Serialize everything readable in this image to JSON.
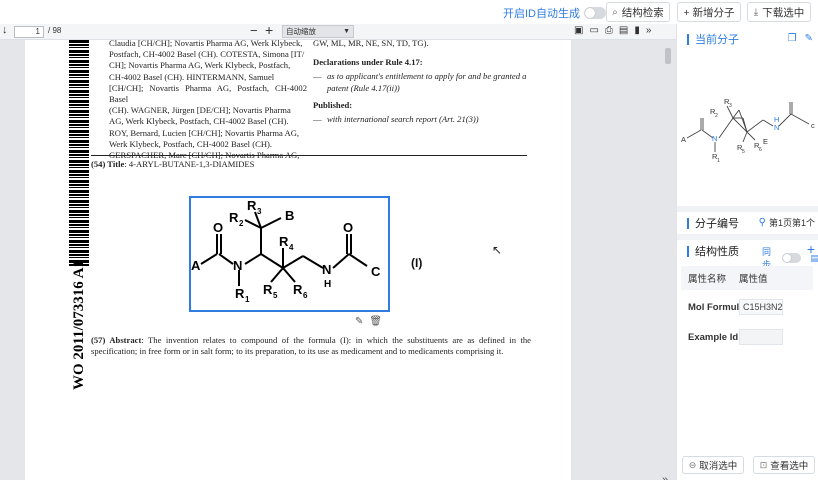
{
  "topbar": {
    "id_toggle_label": "开启ID自动生成",
    "structure_search": "结构检索",
    "add_molecule": "+ 新增分子",
    "download_selected": "下载选中"
  },
  "pdf_toolbar": {
    "back_arrow": "↓",
    "page_current": "1",
    "page_total": "/ 98",
    "zoom_minus": "−",
    "zoom_plus": "+",
    "zoom_value": "自动缩放"
  },
  "document": {
    "wo_number": "WO 2011/073316 A1",
    "left_col_lines": [
      "Claudia [CH/CH]; Novartis Pharma AG, Werk Klybeck,",
      "Postfach, CH-4002 Basel (CH). COTESTA, Simona [IT/",
      "CH]; Novartis Pharma AG, Werk Klybeck, Postfach,",
      "CH-4002 Basel (CH). HINTERMANN, Samuel",
      "[CH/CH]; Novartis Pharma AG, Postfach, CH-4002 Basel",
      "(CH). WAGNER, Jürgen [DE/CH]; Novartis Pharma",
      "AG, Werk Klybeck, Postfach, CH-4002 Basel (CH).",
      "ROY, Bernard, Lucien [CH/CH]; Novartis Pharma AG,",
      "Werk Klybeck, Postfach, CH-4002 Basel (CH).",
      "GERSPACHER, Marc [CH/CH]; Novartis Pharma AG,"
    ],
    "right_col_top": "GW, ML, MR, NE, SN, TD, TG).",
    "declarations_heading": "Declarations under Rule 4.17:",
    "declarations_dash": "—",
    "declarations_text": "as to applicant's entitlement to apply for and be granted a patent (Rule 4.17(ii))",
    "published_heading": "Published:",
    "published_dash": "—",
    "published_text": "with international search report (Art. 21(3))",
    "title_prefix": "(54) Title",
    "title_text": ": 4-ARYL-BUTANE-1,3-DIAMIDES",
    "formula_label": "(I)",
    "abstract_prefix": "(57) Abstract",
    "abstract_text": ": The invention relates to compound of the formula (I): in which the substituents are as defined in the specification; in free form or in salt form; to its preparation, to its use as medicament and to medicaments comprising it.",
    "structure_labels": {
      "A": "A",
      "O1": "O",
      "N1": "N",
      "R1": "R",
      "R1s": "1",
      "R2": "R",
      "R2s": "2",
      "R3": "R",
      "R3s": "3",
      "B": "B",
      "R4": "R",
      "R4s": "4",
      "R5": "R",
      "R5s": "5",
      "R6": "R",
      "R6s": "6",
      "N2": "N",
      "H": "H",
      "O2": "O",
      "C": "C"
    }
  },
  "right_panel": {
    "current_molecule": "当前分子",
    "molecule_id": "分子编号",
    "page_info": "第1页第1个",
    "structure_props": "结构性质",
    "sync_label": "同步",
    "prop_header_name": "属性名称",
    "prop_header_value": "属性值",
    "props": [
      {
        "name": "Mol Formula",
        "value": "C15H3N2C"
      },
      {
        "name": "Example Id",
        "value": ""
      }
    ],
    "cancel_selection": "取消选中",
    "view_selection": "查看选中",
    "mini_labels": {
      "A": "A",
      "N": "N",
      "R1": "R",
      "R1s": "1",
      "R2": "R",
      "R2s": "2",
      "R3": "R",
      "R3s": "3",
      "R5": "R",
      "R5s": "5",
      "R6": "R",
      "R6s": "6",
      "E": "E",
      "H": "H",
      "N2": "N",
      "c": "c"
    }
  },
  "colors": {
    "accent": "#2f7de1",
    "selection_border": "#2f7de1"
  }
}
